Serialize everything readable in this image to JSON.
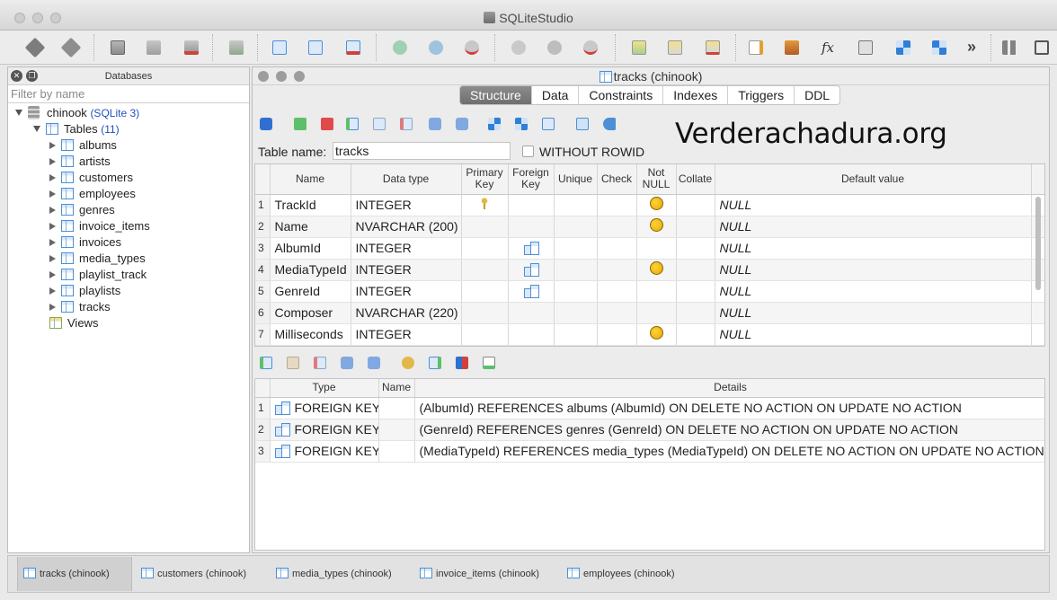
{
  "app": {
    "title": "SQLiteStudio"
  },
  "databases_panel": {
    "title": "Databases",
    "filter_placeholder": "Filter by name",
    "db_name": "chinook",
    "db_type": "(SQLite 3)",
    "tables_label": "Tables",
    "tables_count": "(11)",
    "tables": [
      "albums",
      "artists",
      "customers",
      "employees",
      "genres",
      "invoice_items",
      "invoices",
      "media_types",
      "playlist_track",
      "playlists",
      "tracks"
    ],
    "views_label": "Views"
  },
  "editor": {
    "window_title": "tracks (chinook)",
    "tabs": [
      "Structure",
      "Data",
      "Constraints",
      "Indexes",
      "Triggers",
      "DDL"
    ],
    "active_tab": "Structure",
    "table_name_label": "Table name:",
    "table_name_value": "tracks",
    "without_rowid_label": "WITHOUT ROWID",
    "watermark": "Verderachadura.org",
    "columns_headers": [
      "Name",
      "Data type",
      "Primary\nKey",
      "Foreign\nKey",
      "Unique",
      "Check",
      "Not\nNULL",
      "Collate",
      "Default value"
    ],
    "columns": [
      {
        "n": "1",
        "name": "TrackId",
        "type": "INTEGER",
        "pk": true,
        "fk": false,
        "notnull": true,
        "default": "NULL"
      },
      {
        "n": "2",
        "name": "Name",
        "type": "NVARCHAR (200)",
        "pk": false,
        "fk": false,
        "notnull": true,
        "default": "NULL"
      },
      {
        "n": "3",
        "name": "AlbumId",
        "type": "INTEGER",
        "pk": false,
        "fk": true,
        "notnull": false,
        "default": "NULL"
      },
      {
        "n": "4",
        "name": "MediaTypeId",
        "type": "INTEGER",
        "pk": false,
        "fk": true,
        "notnull": true,
        "default": "NULL"
      },
      {
        "n": "5",
        "name": "GenreId",
        "type": "INTEGER",
        "pk": false,
        "fk": true,
        "notnull": false,
        "default": "NULL"
      },
      {
        "n": "6",
        "name": "Composer",
        "type": "NVARCHAR (220)",
        "pk": false,
        "fk": false,
        "notnull": false,
        "default": "NULL"
      },
      {
        "n": "7",
        "name": "Milliseconds",
        "type": "INTEGER",
        "pk": false,
        "fk": false,
        "notnull": true,
        "default": "NULL"
      }
    ],
    "constraints_headers": [
      "Type",
      "Name",
      "Details"
    ],
    "constraints": [
      {
        "n": "1",
        "type": "FOREIGN KEY",
        "name": "",
        "details": "(AlbumId) REFERENCES albums (AlbumId) ON DELETE NO ACTION ON UPDATE NO ACTION"
      },
      {
        "n": "2",
        "type": "FOREIGN KEY",
        "name": "",
        "details": "(GenreId) REFERENCES genres (GenreId) ON DELETE NO ACTION ON UPDATE NO ACTION"
      },
      {
        "n": "3",
        "type": "FOREIGN KEY",
        "name": "",
        "details": "(MediaTypeId) REFERENCES media_types (MediaTypeId) ON DELETE NO ACTION ON UPDATE NO ACTION"
      }
    ]
  },
  "bottom_tabs": [
    "tracks (chinook)",
    "customers (chinook)",
    "media_types (chinook)",
    "invoice_items (chinook)",
    "employees (chinook)"
  ],
  "toolbar": {
    "more": "»",
    "function_glyph": "fx",
    "icons": [
      "connect-icon",
      "disconnect-icon",
      "add-database-icon",
      "edit-database-icon",
      "remove-database-icon",
      "import-icon",
      "create-table-icon",
      "edit-table-icon",
      "drop-table-icon",
      "create-index-icon",
      "edit-index-icon",
      "drop-index-icon",
      "create-trigger-icon",
      "edit-trigger-icon",
      "drop-trigger-icon",
      "create-view-icon",
      "edit-view-icon",
      "drop-view-icon",
      "sql-editor-icon",
      "open-icon",
      "functions-icon",
      "collations-icon",
      "tile-icon",
      "tile-horizontal-icon",
      "grid-icon",
      "window-icon"
    ]
  }
}
